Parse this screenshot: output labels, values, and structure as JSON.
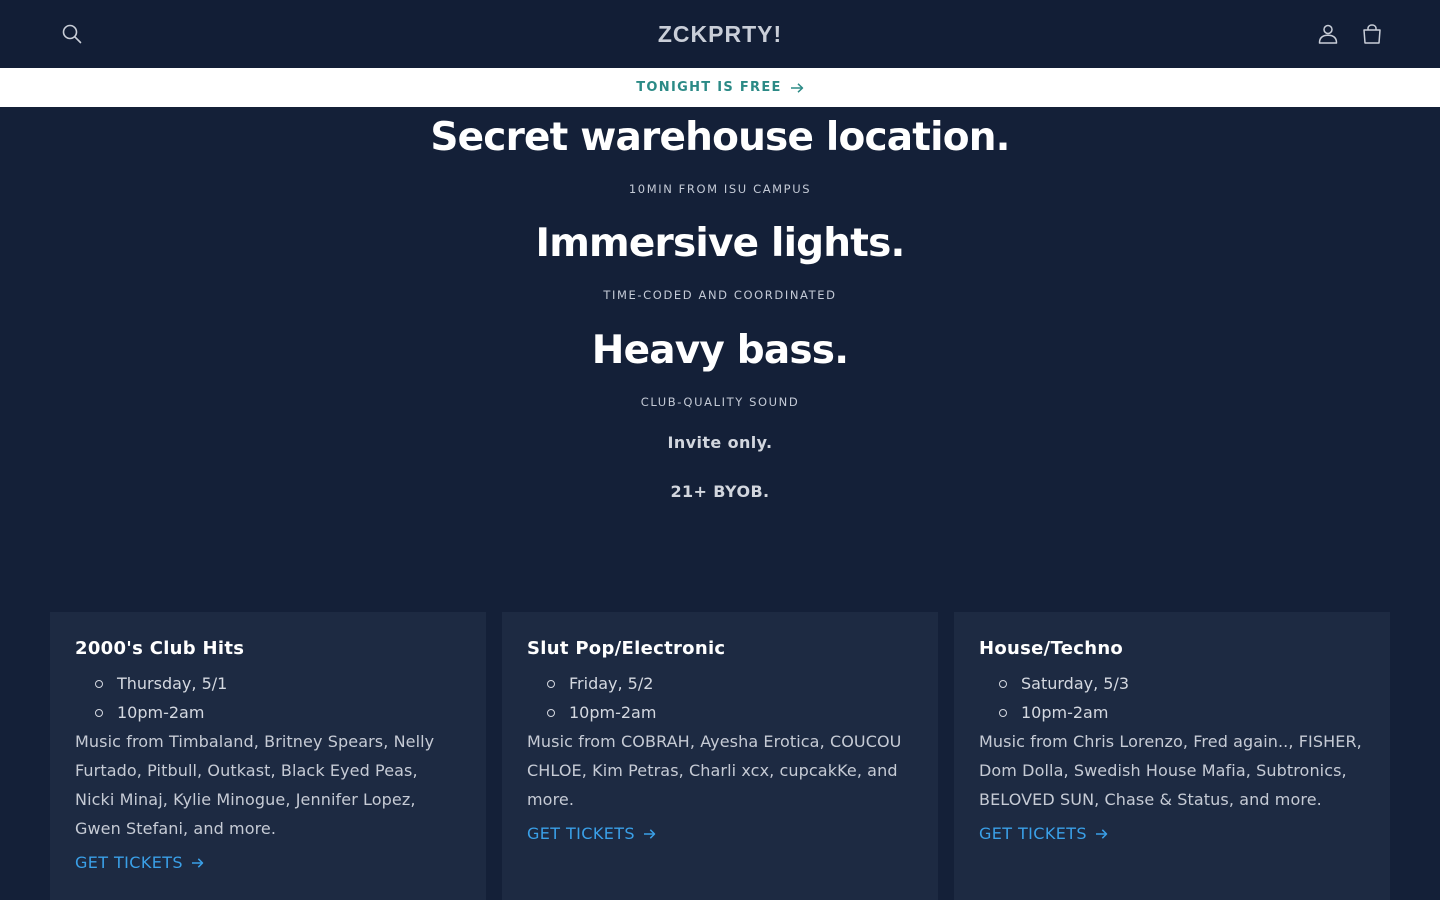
{
  "header": {
    "logo": "ZCKPRTY!",
    "icons": [
      "search-icon",
      "account-icon",
      "cart-icon"
    ]
  },
  "announcement": {
    "text": "TONIGHT IS FREE",
    "icon": "arrow-right-icon",
    "color": "#2b8a86"
  },
  "hero": {
    "blocks": [
      {
        "title": "Secret warehouse location.",
        "subtitle": "10MIN FROM ISU CAMPUS"
      },
      {
        "title": "Immersive lights.",
        "subtitle": "TIME-CODED AND COORDINATED"
      },
      {
        "title": "Heavy bass.",
        "subtitle": "CLUB-QUALITY SOUND"
      }
    ],
    "notes": [
      "Invite only.",
      "21+ BYOB."
    ]
  },
  "events": [
    {
      "title": "2000's Club Hits",
      "day": "Thursday, 5/1",
      "time": "10pm-2am",
      "description": "Music from Timbaland, Britney Spears, Nelly Furtado, Pitbull, Outkast, Black Eyed Peas, Nicki Minaj, Kylie Minogue, Jennifer Lopez, Gwen Stefani, and more.",
      "cta": "GET TICKETS"
    },
    {
      "title": "Slut Pop/Electronic",
      "day": "Friday, 5/2",
      "time": "10pm-2am",
      "description": "Music from COBRAH, Ayesha Erotica, COUCOU CHLOE, Kim Petras, Charli xcx, cupcakKe, and more.",
      "cta": "GET TICKETS"
    },
    {
      "title": "House/Techno",
      "day": "Saturday, 5/3",
      "time": "10pm-2am",
      "description": "Music from Chris Lorenzo, Fred again.., FISHER, Dom Dolla, Swedish House Mafia, Subtronics, BELOVED SUN, Chase & Status, and more.",
      "cta": "GET TICKETS"
    }
  ],
  "colors": {
    "background": "#142038",
    "header": "#121e36",
    "card": "#1d2a42",
    "link": "#3aa0e8"
  }
}
